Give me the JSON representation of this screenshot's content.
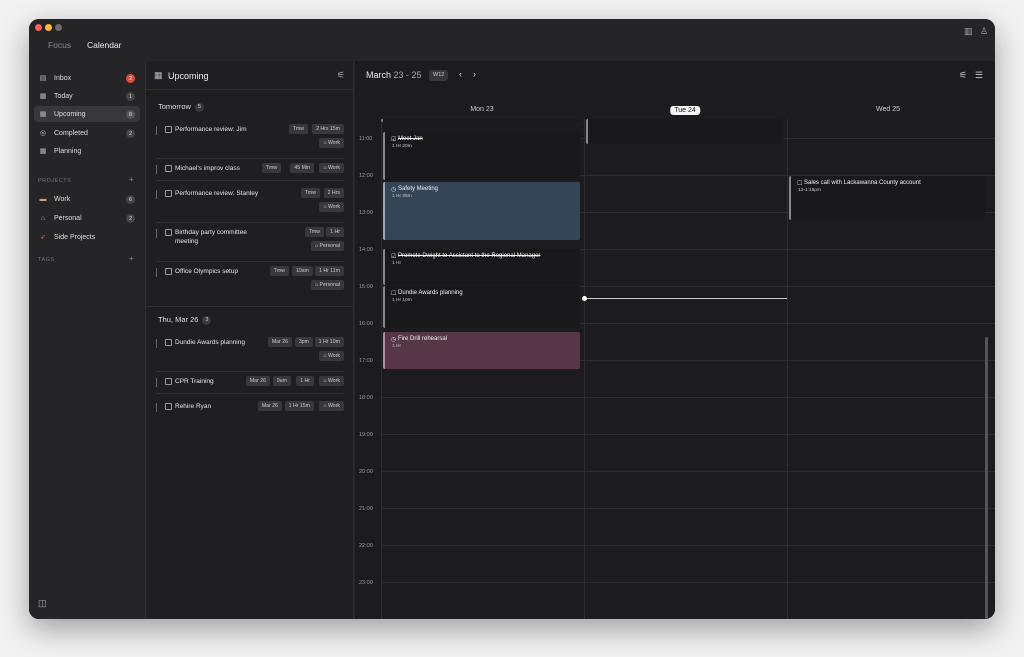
{
  "titlebar": {
    "tabs": [
      "Focus",
      "Calendar"
    ],
    "active_tab": "Calendar"
  },
  "sidebar": {
    "items": [
      {
        "label": "Inbox",
        "icon": "inbox-icon",
        "badge": "2"
      },
      {
        "label": "Today",
        "icon": "today-icon",
        "badge": "1"
      },
      {
        "label": "Upcoming",
        "icon": "calendar-icon",
        "badge": "8"
      },
      {
        "label": "Completed",
        "icon": "check-circle-icon",
        "badge": "2"
      },
      {
        "label": "Planning",
        "icon": "planning-icon",
        "badge": ""
      }
    ],
    "projects_header": "PROJECTS",
    "projects": [
      {
        "label": "Work",
        "icon": "work-emoji-icon",
        "badge": "6"
      },
      {
        "label": "Personal",
        "icon": "house-emoji-icon",
        "badge": "2"
      },
      {
        "label": "Side Projects",
        "icon": "rocket-emoji-icon",
        "badge": ""
      }
    ],
    "tags_header": "TAGS"
  },
  "upcoming": {
    "title": "Upcoming",
    "groups": [
      {
        "title": "Tomorrow",
        "count": "5"
      },
      {
        "title": "Thu, Mar 26",
        "count": "3"
      }
    ],
    "tasks": [
      {
        "title": "Performance review: Jim",
        "chips": [
          "Tmw",
          "2 Hrs 15m"
        ],
        "tag": "Work"
      },
      {
        "title": "Michael's improv class",
        "chips": [
          "Tmw",
          "45 Min"
        ],
        "tag": "Work"
      },
      {
        "title": "Performance review: Stanley",
        "chips": [
          "Tmw",
          "2 Hrs"
        ],
        "tag": "Work"
      },
      {
        "title": "Birthday party committee",
        "title2": "meeting",
        "chips": [
          "Tmw",
          "1 Hr"
        ],
        "tag": "Personal"
      },
      {
        "title": "Office Olympics setup",
        "chips": [
          "Tmw",
          "10am",
          "1 Hr 11m"
        ],
        "tag": "Personal"
      },
      {
        "title": "Dundie Awards planning",
        "chips": [
          "Mar 26",
          "3pm",
          "1 Hr 10m"
        ],
        "tag": "Work"
      },
      {
        "title": "CPR Training",
        "chips": [
          "Mar 26",
          "9am",
          "1 Hr"
        ],
        "tag": "Work"
      },
      {
        "title": "Rehire Ryan",
        "chips": [
          "Mar 26",
          "1 Hr 15m"
        ],
        "tag": "Work"
      }
    ]
  },
  "calendar": {
    "range_month": "March",
    "range_days": "23 - 25",
    "week": "W12",
    "days": [
      "Mon 23",
      "Tue 24",
      "Wed 25"
    ],
    "today": "Tue 24",
    "hours": [
      "11:00",
      "12:00",
      "13:00",
      "14:00",
      "15:00",
      "16:00",
      "17:00",
      "18:00",
      "19:00",
      "20:00",
      "21:00",
      "22:00",
      "23:00"
    ],
    "events": [
      {
        "title": "Meet Jan",
        "sub": "1 Hr 20m",
        "status": "checked",
        "color": "#19191b"
      },
      {
        "title": "Safety Meeting",
        "sub": "1 Hr 35m",
        "status": "recurring",
        "color": "#344558"
      },
      {
        "title": "Promote Dwight to Assistant to the Regional Manager",
        "sub": "1 Hr",
        "status": "checked",
        "color": "#19191b"
      },
      {
        "title": "Dundie Awards planning",
        "sub": "1 Hr 10m",
        "status": "open",
        "color": "#19191b"
      },
      {
        "title": "Fire Drill rehearsal",
        "sub": "1 Hr",
        "status": "recurring",
        "color": "#563647"
      },
      {
        "title": "Sales call with Lackawanna County account",
        "sub": "12-1:15pm",
        "status": "open",
        "color": "#19191b"
      }
    ]
  }
}
